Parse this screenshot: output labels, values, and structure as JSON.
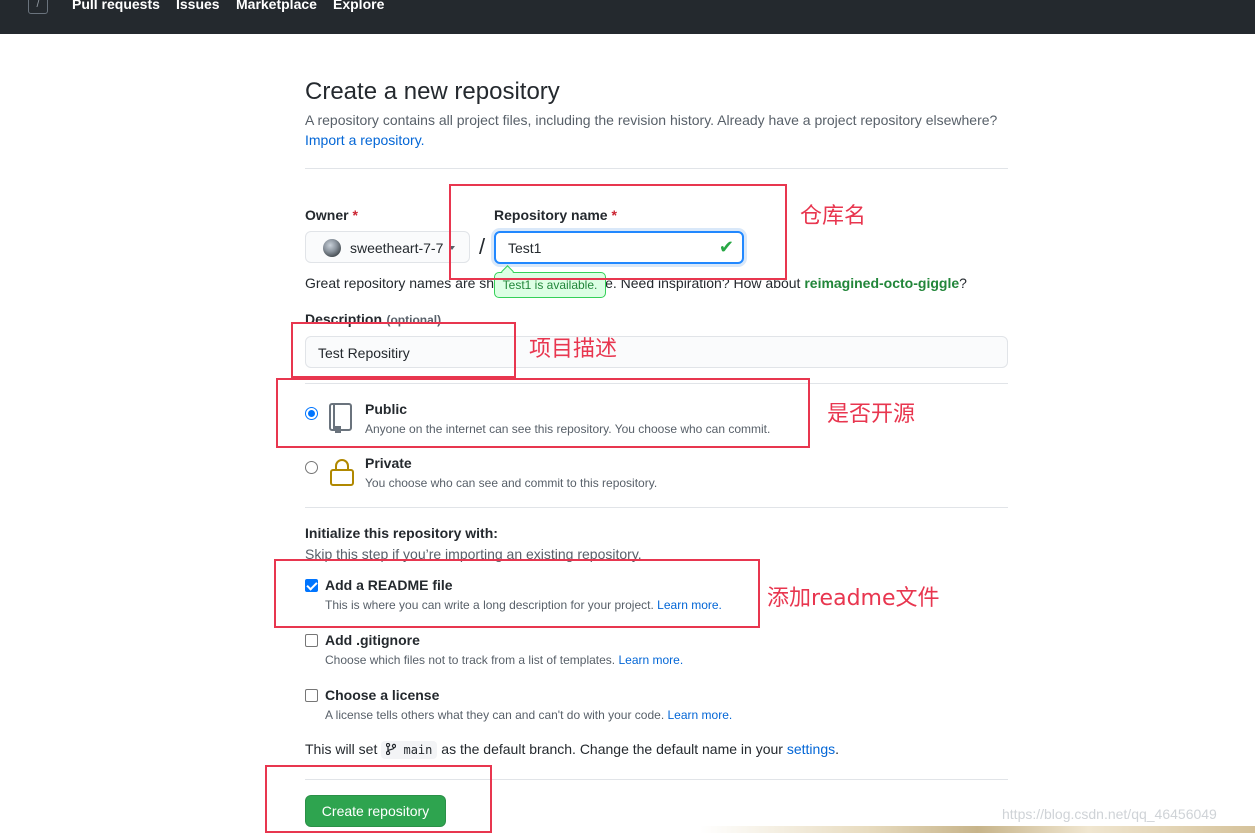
{
  "topbar": {
    "slash_key": "/",
    "nav": [
      "Pull requests",
      "Issues",
      "Marketplace",
      "Explore"
    ]
  },
  "page": {
    "title": "Create a new repository",
    "subtitle": "A repository contains all project files, including the revision history. Already have a project repository elsewhere?",
    "import_link": "Import a repository."
  },
  "owner": {
    "label": "Owner",
    "required_mark": "*",
    "value": "sweetheart-7-7"
  },
  "separator": "/",
  "repo_name": {
    "label": "Repository name",
    "required_mark": "*",
    "value": "Test1",
    "availability": "Test1 is available."
  },
  "hint": {
    "prefix": "Great repository names are sh",
    "middle": "e. Need inspiration? How about ",
    "suggestion": "reimagined-octo-giggle",
    "suffix": "?"
  },
  "description": {
    "label": "Description",
    "optional": "(optional)",
    "value": "Test Repositiry"
  },
  "visibility": {
    "selected": "Public",
    "options": [
      {
        "title": "Public",
        "desc": "Anyone on the internet can see this repository. You choose who can commit."
      },
      {
        "title": "Private",
        "desc": "You choose who can see and commit to this repository."
      }
    ]
  },
  "initialize": {
    "heading": "Initialize this repository with:",
    "subheading": "Skip this step if you’re importing an existing repository.",
    "options": [
      {
        "title": "Add a README file",
        "desc": "This is where you can write a long description for your project.",
        "link": "Learn more.",
        "checked": true
      },
      {
        "title": "Add .gitignore",
        "desc": "Choose which files not to track from a list of templates.",
        "link": "Learn more.",
        "checked": false
      },
      {
        "title": "Choose a license",
        "desc": "A license tells others what they can and can't do with your code.",
        "link": "Learn more.",
        "checked": false
      }
    ]
  },
  "default_branch": {
    "prefix": "This will set",
    "branch": "main",
    "middle": "as the default branch. Change the default name in your",
    "link": "settings",
    "suffix": "."
  },
  "create_button": "Create repository",
  "annotations": {
    "repo_name": "仓库名",
    "description": "项目描述",
    "visibility": "是否开源",
    "readme": "添加readme文件",
    "color": "#e8364f"
  },
  "watermark": "https://blog.csdn.net/qq_46456049",
  "colors": {
    "accent": "#0366d6",
    "success": "#28a745",
    "button": "#2ea44f",
    "header": "#24292e"
  }
}
